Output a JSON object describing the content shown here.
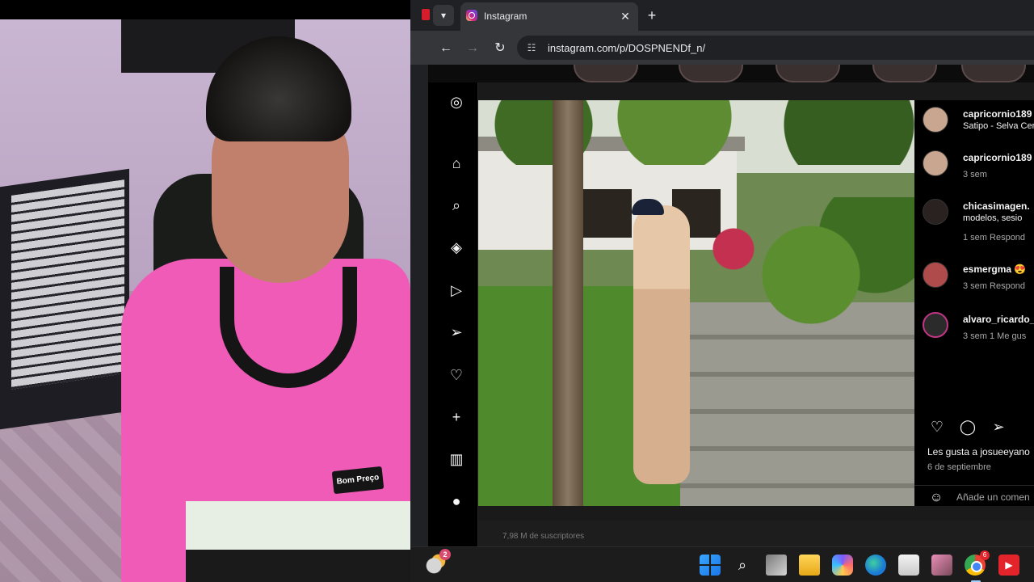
{
  "browser": {
    "tab": {
      "title": "Instagram",
      "close_icon": "close-icon"
    },
    "url": "instagram.com/p/DOSPNENDf_n/"
  },
  "instagram": {
    "comments": [
      {
        "user": "capricornio189",
        "line2": "Satipo - Selva Cer"
      },
      {
        "user": "capricornio189",
        "meta": "3 sem"
      },
      {
        "user": "chicasimagen.",
        "line2": "modelos, sesio",
        "meta": "1 sem   Respond"
      },
      {
        "user": "esmergma 😍",
        "meta": "3 sem   Respond"
      },
      {
        "user": "alvaro_ricardo_",
        "meta": "3 sem   1 Me gus"
      }
    ],
    "likes": "Les gusta a josueeyano",
    "date": "6 de septiembre",
    "add_comment_placeholder": "Añade un comen",
    "below_text": "7,98 M de suscriptores"
  },
  "webcam": {
    "shirt_badge": "Bom Preço"
  },
  "taskbar": {
    "weather_badge": "2",
    "chrome_badge": "6"
  }
}
